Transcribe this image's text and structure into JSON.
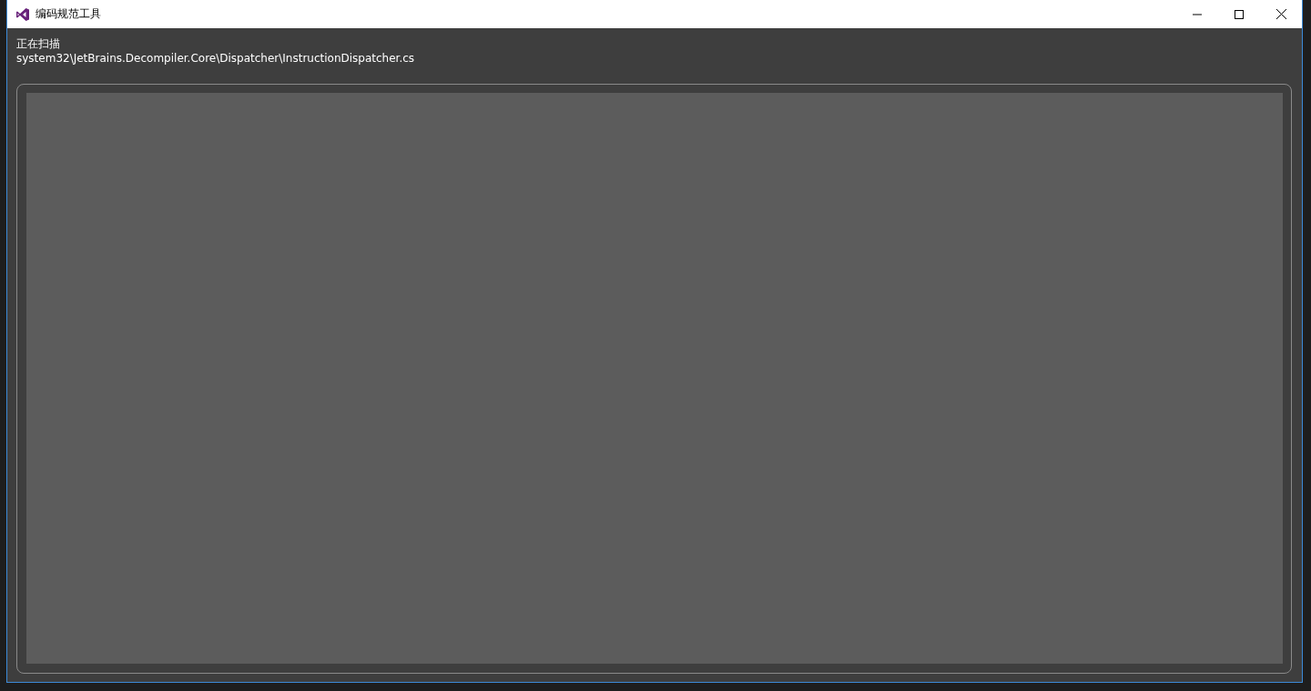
{
  "window": {
    "title": "编码规范工具"
  },
  "scan": {
    "label": "正在扫描",
    "path": "system32\\JetBrains.Decompiler.Core\\Dispatcher\\InstructionDispatcher.cs"
  }
}
